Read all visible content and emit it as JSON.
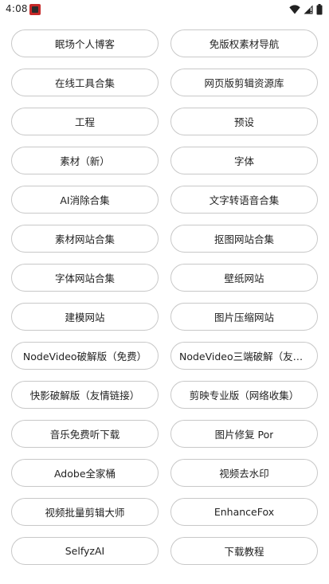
{
  "status_bar": {
    "time": "4:08",
    "icons": [
      "app-notification-icon",
      "wifi-icon",
      "cellular-signal-icon",
      "battery-icon"
    ]
  },
  "links": [
    {
      "label": "眠场个人博客"
    },
    {
      "label": "免版权素材导航"
    },
    {
      "label": "在线工具合集"
    },
    {
      "label": "网页版剪辑资源库"
    },
    {
      "label": "工程"
    },
    {
      "label": "预设"
    },
    {
      "label": "素材（新）"
    },
    {
      "label": "字体"
    },
    {
      "label": "AI消除合集"
    },
    {
      "label": "文字转语音合集"
    },
    {
      "label": "素材网站合集"
    },
    {
      "label": "抠图网站合集"
    },
    {
      "label": "字体网站合集"
    },
    {
      "label": "壁纸网站"
    },
    {
      "label": "建模网站"
    },
    {
      "label": "图片压缩网站"
    },
    {
      "label": "NodeVideo破解版（免费）"
    },
    {
      "label": "NodeVideo三端破解（友情…"
    },
    {
      "label": "快影破解版（友情链接）"
    },
    {
      "label": "剪映专业版（网络收集）"
    },
    {
      "label": "音乐免费听下载"
    },
    {
      "label": "图片修复 Por"
    },
    {
      "label": "Adobe全家桶"
    },
    {
      "label": "视频去水印"
    },
    {
      "label": "视频批量剪辑大师"
    },
    {
      "label": "EnhanceFox"
    },
    {
      "label": "SelfyzAI"
    },
    {
      "label": "下载教程"
    }
  ]
}
